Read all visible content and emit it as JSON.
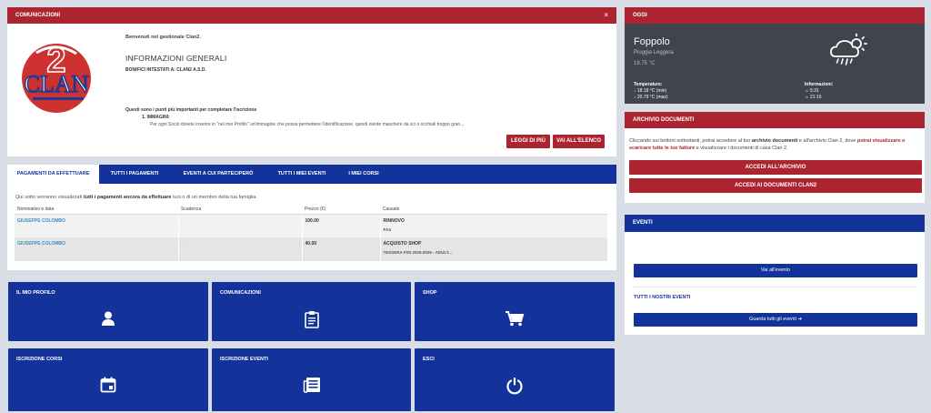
{
  "comunicazioni": {
    "title": "COMUNICAZIONI",
    "close": "×",
    "logo_text": "CLAN",
    "logo_number": "2",
    "welcome": "Benvenuti nel gestionale Clan2.",
    "info_title": "INFORMAZIONI GENERALI",
    "bonifici": "BONIFICI INTESTATI A: CLAN2 A.S.D.",
    "punti_intro": "Questi sono i punti più importanti per completare l'iscrizione",
    "punti_item": "1.  IMMAGINI:",
    "punti_text": "Per ogni Socio dovete inserire in \"nel mio Profilo\" un'immagine che possa permettere l'identificazione, quindi niente maschere da sci o occhiali troppo gran...",
    "btn_leggi": "LEGGI DI PIÙ",
    "btn_elenco": "VAI ALL'ELENCO"
  },
  "payments": {
    "tabs": [
      "PAGAMENTI DA EFFETTUARE",
      "TUTTI I PAGAMENTI",
      "EVENTI A CUI PARTECIPERÒ",
      "TUTTI I MIEI EVENTI",
      "I MIEI CORSI"
    ],
    "intro_pre": "Qui sotto verranno visualizzati ",
    "intro_bold": "tutti i pagamenti ancora da effettuare",
    "intro_post": " tuoi o di un membro della tua famiglia.",
    "columns": [
      "Nominativo e data",
      "Scadenza",
      "Prezzo (€)",
      "Causale"
    ],
    "rows": [
      {
        "name": "GIUSEPPE COLOMBO",
        "scadenza": "-",
        "prezzo": "100.00",
        "causale": "RINNOVO",
        "sub": "FAS"
      },
      {
        "name": "GIUSEPPE COLOMBO",
        "scadenza": "-",
        "prezzo": "40.00",
        "causale": "ACQUISTO SHOP",
        "sub": "TESSERA FISI 2025-2026 - ADULT..."
      }
    ]
  },
  "tiles": [
    {
      "label": "IL MIO PROFILO",
      "icon": "user-icon"
    },
    {
      "label": "COMUNICAZIONI",
      "icon": "clipboard-icon"
    },
    {
      "label": "SHOP",
      "icon": "cart-icon"
    },
    {
      "label": "ISCRIZIONE CORSI",
      "icon": "calendar-icon"
    },
    {
      "label": "ISCRIZIONE EVENTI",
      "icon": "newspaper-icon"
    },
    {
      "label": "ESCI",
      "icon": "power-icon"
    }
  ],
  "oggi": {
    "title": "OGGI",
    "city": "Foppolo",
    "desc": "Pioggia Leggera",
    "temp": "19.75 °C",
    "temp_label": "Temperature:",
    "temp_min": "↓ 18.18 °C (min)",
    "temp_max": "↓ 20.79 °C (max)",
    "info_label": "Informazioni:",
    "sunrise": "5:31",
    "sunset": "21:16",
    "weather_icon": "cloud-rain-sun-icon"
  },
  "archivio": {
    "title": "ARCHIVIO DOCUMENTI",
    "t1": "Cliccando sui bottoni sottostanti, potrai accedere al tuo ",
    "t2": "archivio documenti",
    "t3": " e all'archivio Clan 2, dove ",
    "t4": "potrai visualizzare o scaricare tutte le tue fatture",
    "t5": " e visualizzare i documenti di casa Clan 2.",
    "btn1": "ACCEDI ALL'ARCHIVIO",
    "btn2": "ACCEDI AI DOCUMENTI CLAN2"
  },
  "eventi": {
    "title": "EVENTI",
    "btn_vai": "Vai all'evento",
    "subtitle": "TUTTI I NOSTRI EVENTI",
    "btn_tutti": "Guarda tutti gli eventi ➔"
  },
  "colors": {
    "red": "#ad2431",
    "blue": "#13339a",
    "dark": "#41434d",
    "bg": "#d9dde6"
  }
}
